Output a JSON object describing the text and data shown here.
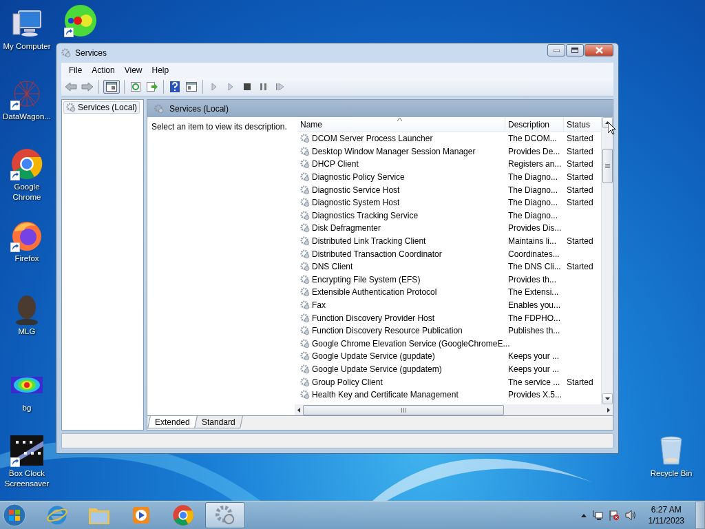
{
  "desktop_icons": [
    {
      "label": "My Computer",
      "shortcut": false
    },
    {
      "shortcut": true
    },
    {
      "label": "DataWagon...",
      "shortcut": true
    },
    {
      "label": "Google Chrome",
      "shortcut": true
    },
    {
      "label": "Firefox",
      "shortcut": true
    },
    {
      "label": "MLG",
      "shortcut": false
    },
    {
      "label": "bg",
      "shortcut": false
    },
    {
      "label": "Box Clock Screensaver",
      "shortcut": true
    },
    {
      "label": "Recycle Bin",
      "shortcut": false
    }
  ],
  "window": {
    "title": "Services",
    "menu": [
      "File",
      "Action",
      "View",
      "Help"
    ],
    "tree": {
      "items": [
        {
          "label": "Services (Local)",
          "selected": true
        }
      ]
    },
    "pane_title": "Services (Local)",
    "description_hint": "Select an item to view its description.",
    "table": {
      "columns": [
        "Name",
        "Description",
        "Status"
      ],
      "rows": [
        {
          "name": "DCOM Server Process Launcher",
          "description": "The DCOM...",
          "status": "Started"
        },
        {
          "name": "Desktop Window Manager Session Manager",
          "description": "Provides De...",
          "status": "Started"
        },
        {
          "name": "DHCP Client",
          "description": "Registers an...",
          "status": "Started"
        },
        {
          "name": "Diagnostic Policy Service",
          "description": "The Diagno...",
          "status": "Started"
        },
        {
          "name": "Diagnostic Service Host",
          "description": "The Diagno...",
          "status": "Started"
        },
        {
          "name": "Diagnostic System Host",
          "description": "The Diagno...",
          "status": "Started"
        },
        {
          "name": "Diagnostics Tracking Service",
          "description": "The Diagno..."
        },
        {
          "name": "Disk Defragmenter",
          "description": "Provides Dis..."
        },
        {
          "name": "Distributed Link Tracking Client",
          "description": "Maintains li...",
          "status": "Started"
        },
        {
          "name": "Distributed Transaction Coordinator",
          "description": "Coordinates..."
        },
        {
          "name": "DNS Client",
          "description": "The DNS Cli...",
          "status": "Started"
        },
        {
          "name": "Encrypting File System (EFS)",
          "description": "Provides th..."
        },
        {
          "name": "Extensible Authentication Protocol",
          "description": "The Extensi..."
        },
        {
          "name": "Fax",
          "description": "Enables you..."
        },
        {
          "name": "Function Discovery Provider Host",
          "description": "The FDPHO..."
        },
        {
          "name": "Function Discovery Resource Publication",
          "description": "Publishes th..."
        },
        {
          "name": "Google Chrome Elevation Service (GoogleChromeE..."
        },
        {
          "name": "Google Update Service (gupdate)",
          "description": "Keeps your ..."
        },
        {
          "name": "Google Update Service (gupdatem)",
          "description": "Keeps your ..."
        },
        {
          "name": "Group Policy Client",
          "description": "The service ...",
          "status": "Started"
        },
        {
          "name": "Health Key and Certificate Management",
          "description": "Provides X.5..."
        }
      ]
    },
    "tabs": [
      {
        "label": "Extended",
        "selected": true
      },
      {
        "label": "Standard",
        "selected": false
      }
    ]
  },
  "taskbar": {
    "items": [
      {
        "selected": false
      },
      {
        "selected": false
      },
      {
        "selected": false
      },
      {
        "selected": false
      },
      {
        "selected": true
      }
    ],
    "clock": {
      "time": "6:27 AM",
      "date": "1/11/2023"
    }
  }
}
